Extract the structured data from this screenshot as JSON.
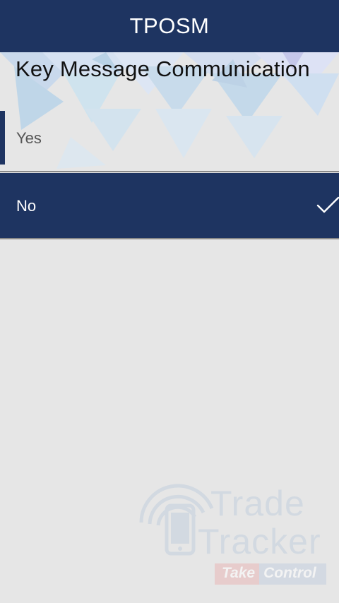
{
  "header": {
    "title": "TPOSM"
  },
  "question": {
    "text": "Key Message Communication"
  },
  "options": [
    {
      "label": "Yes",
      "selected": false
    },
    {
      "label": "No",
      "selected": true,
      "indicator_icon": "checkmark-icon"
    }
  ],
  "watermark": {
    "logo_line1": "Trade",
    "logo_line2": "Tracker",
    "tagline_part1": "Take",
    "tagline_part2": "Control",
    "icon": "phone-signal-icon"
  },
  "colors": {
    "primary": "#1e3461",
    "background": "#e6e6e6",
    "question_text": "#111111",
    "unselected_text": "#555555",
    "selected_text": "#ffffff"
  }
}
